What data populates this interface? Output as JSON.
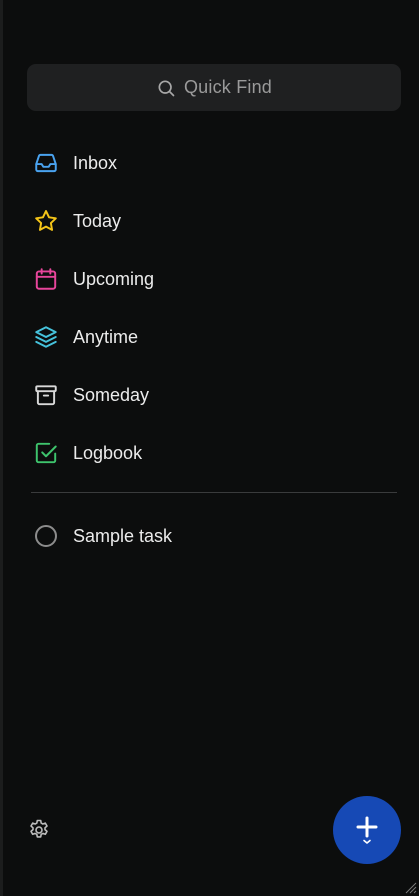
{
  "search": {
    "placeholder": "Quick Find",
    "icon": "search-icon"
  },
  "nav": {
    "items": [
      {
        "label": "Inbox",
        "icon": "inbox-icon",
        "color": "#4aa3f0"
      },
      {
        "label": "Today",
        "icon": "star-icon",
        "color": "#f5c518"
      },
      {
        "label": "Upcoming",
        "icon": "calendar-icon",
        "color": "#e8459b"
      },
      {
        "label": "Anytime",
        "icon": "layers-icon",
        "color": "#46c3dc"
      },
      {
        "label": "Someday",
        "icon": "archive-icon",
        "color": "#d9d9d9"
      },
      {
        "label": "Logbook",
        "icon": "checkbox-icon",
        "color": "#3ec46d"
      }
    ]
  },
  "tasks": [
    {
      "label": "Sample task",
      "completed": false
    }
  ],
  "footer": {
    "settings_icon": "gear-icon",
    "fab_icon": "plus-icon",
    "fab_color": "#1649b5"
  }
}
